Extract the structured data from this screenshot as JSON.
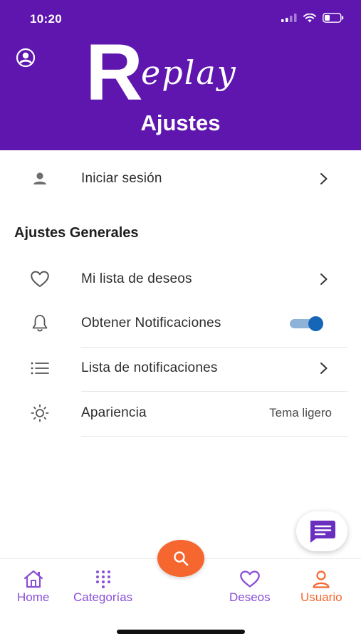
{
  "status_bar": {
    "time": "10:20"
  },
  "header": {
    "brand_letter": "R",
    "brand_script": "eplay",
    "title": "Ajustes"
  },
  "login": {
    "label": "Iniciar sesión"
  },
  "general": {
    "section_title": "Ajustes Generales",
    "items": [
      {
        "label": "Mi lista de deseos",
        "icon": "heart-icon",
        "trailing": "chevron"
      },
      {
        "label": "Obtener Notificaciones",
        "icon": "bell-icon",
        "trailing": "toggle",
        "toggle_on": true
      },
      {
        "label": "Lista de notificaciones",
        "icon": "list-icon",
        "trailing": "chevron"
      },
      {
        "label": "Apariencia",
        "icon": "sun-icon",
        "trailing": "value",
        "value": "Tema ligero"
      }
    ]
  },
  "bottom_nav": {
    "items": [
      {
        "label": "Home",
        "icon": "home-icon"
      },
      {
        "label": "Categorías",
        "icon": "grid-icon"
      },
      {
        "label": "Deseos",
        "icon": "heart-icon"
      },
      {
        "label": "Usuario",
        "icon": "user-icon",
        "active": true
      }
    ]
  },
  "colors": {
    "primary": "#5f16ae",
    "accent": "#f6662f",
    "nav_inactive": "#8a4fd6",
    "toggle": "#1666b8"
  }
}
